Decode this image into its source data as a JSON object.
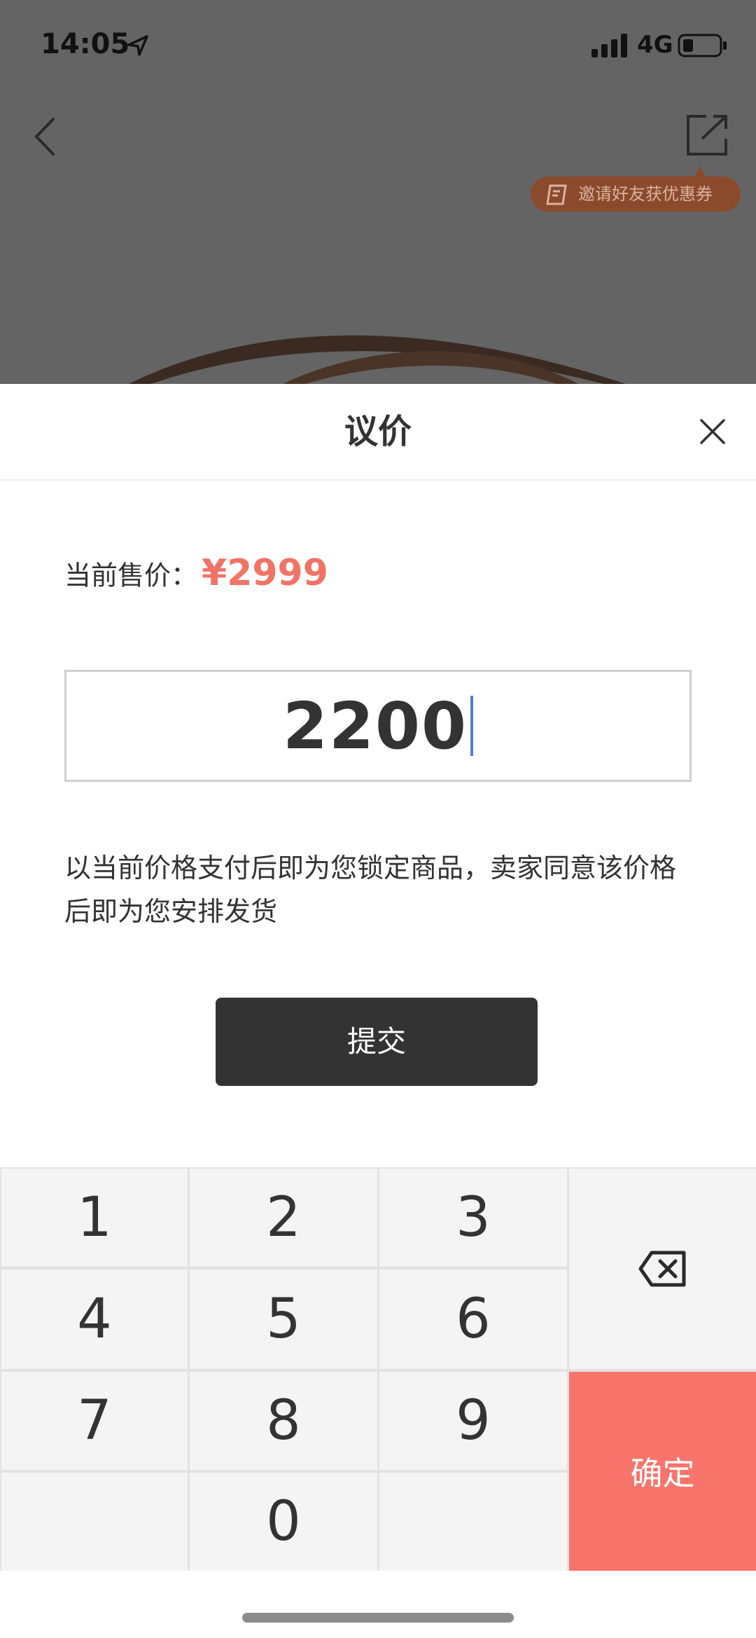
{
  "status_bar": {
    "time": "14:05",
    "network": "4G"
  },
  "background": {
    "invite_badge": "邀请好友获优惠券",
    "icons": [
      "location-arrow-icon",
      "signal-icon",
      "battery-icon",
      "back-icon",
      "share-icon",
      "coupon-icon"
    ]
  },
  "sheet": {
    "title": "议价",
    "price_label": "当前售价：",
    "price_value": "¥2999",
    "offer_value": "2200",
    "note": "以当前价格支付后即为您锁定商品，卖家同意该价格后即为您安排发货",
    "submit_label": "提交"
  },
  "keypad": {
    "keys": [
      "1",
      "2",
      "3",
      "4",
      "5",
      "6",
      "7",
      "8",
      "9",
      "0"
    ],
    "delete_icon": "backspace-icon",
    "confirm_label": "确定"
  },
  "colors": {
    "accent": "#f27366",
    "confirm": "#f9746a",
    "submit_bg": "#333333",
    "caret": "#4a7fd6",
    "overlay": "#646464"
  }
}
